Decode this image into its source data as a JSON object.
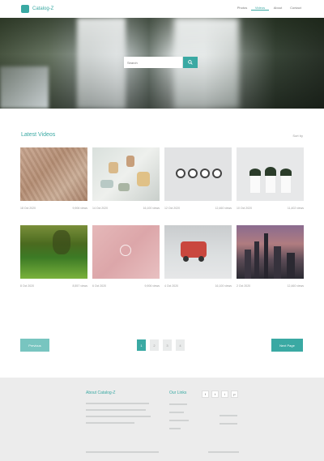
{
  "header": {
    "logo_text": "Catalog-Z",
    "nav": [
      "Photos",
      "Videos",
      "About",
      "Contact"
    ],
    "active_nav": "Videos"
  },
  "hero": {
    "search_placeholder": "Search",
    "search_icon": "search-icon"
  },
  "videos": {
    "title": "Latest Videos",
    "sort_label": "Sort by",
    "items": [
      {
        "date": "18 Oct 2020",
        "views": "9,906 views"
      },
      {
        "date": "14 Oct 2020",
        "views": "16,100 views"
      },
      {
        "date": "12 Oct 2020",
        "views": "12,460 views"
      },
      {
        "date": "10 Oct 2020",
        "views": "11,402 views"
      },
      {
        "date": "8 Oct 2020",
        "views": "8,557 views"
      },
      {
        "date": "6 Oct 2020",
        "views": "9,906 views"
      },
      {
        "date": "4 Oct 2020",
        "views": "16,100 views"
      },
      {
        "date": "2 Oct 2020",
        "views": "12,460 views"
      }
    ]
  },
  "pagination": {
    "previous_label": "Previous",
    "next_label": "Next Page",
    "pages": [
      "1",
      "2",
      "3",
      "4"
    ],
    "current_page": "1"
  },
  "footer": {
    "about_title": "About Catalog-Z",
    "links_title": "Our Links",
    "social_icons": [
      "facebook-icon",
      "twitter-icon",
      "instagram-icon",
      "pinterest-icon"
    ],
    "social_glyphs": [
      "f",
      "t",
      "i",
      "p"
    ]
  },
  "colors": {
    "accent": "#3aa9a3",
    "accent_light": "#78c5c0",
    "footer_bg": "#ececec"
  }
}
